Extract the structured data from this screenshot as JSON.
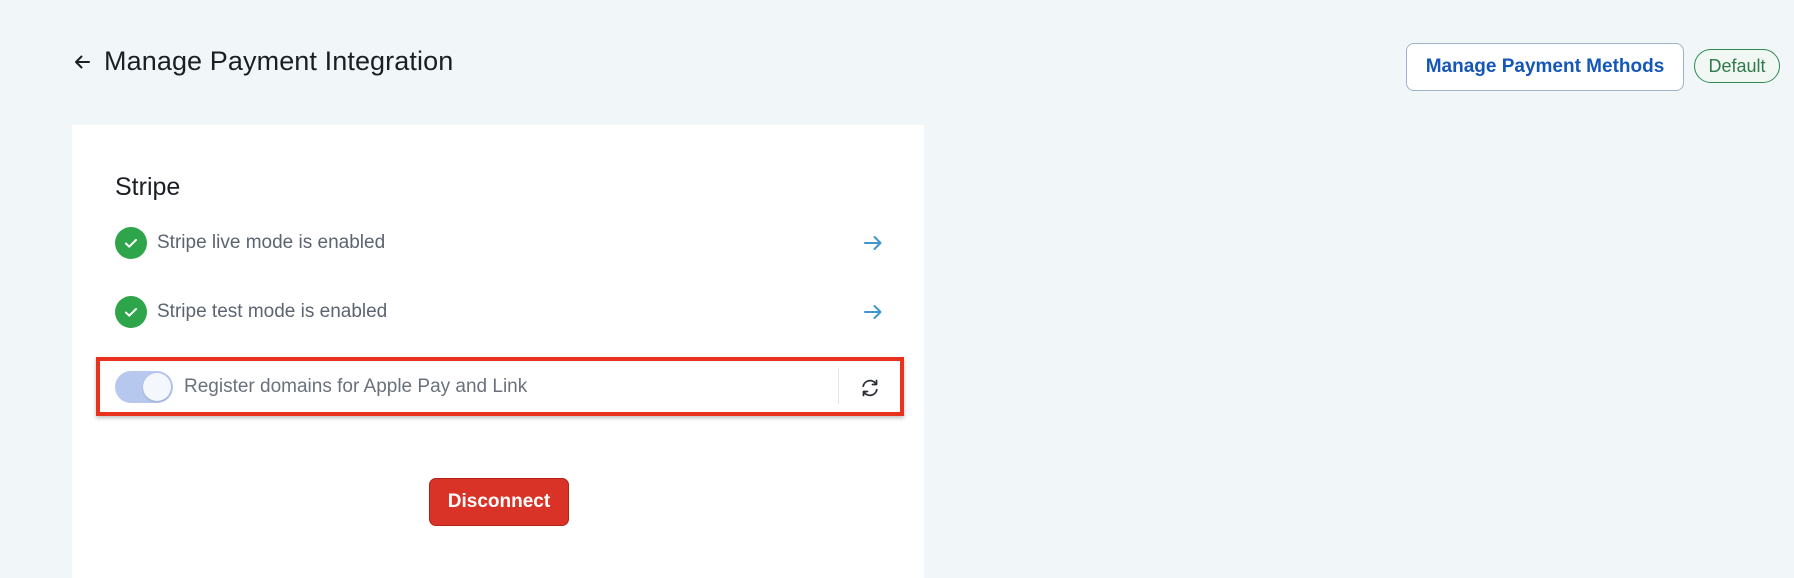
{
  "header": {
    "back_icon": "arrow-left-icon",
    "title": "Manage Payment Integration",
    "manage_button_label": "Manage Payment Methods",
    "default_badge": "Default"
  },
  "card": {
    "title": "Stripe",
    "status_rows": [
      {
        "label": "Stripe live mode is enabled",
        "status": "enabled",
        "icon": "check-circle-icon",
        "action_icon": "arrow-right-icon"
      },
      {
        "label": "Stripe test mode is enabled",
        "status": "enabled",
        "icon": "check-circle-icon",
        "action_icon": "arrow-right-icon"
      }
    ],
    "domain_toggle": {
      "label": "Register domains for Apple Pay and Link",
      "checked": true,
      "action_icon": "refresh-icon"
    },
    "disconnect_label": "Disconnect"
  },
  "colors": {
    "background": "#f1f6f9",
    "primary_link": "#1557b8",
    "success": "#2ea54a",
    "danger": "#d93226",
    "highlight": "#e8321d",
    "arrow": "#3f95d1",
    "toggle_on": "#b7c8ef"
  }
}
